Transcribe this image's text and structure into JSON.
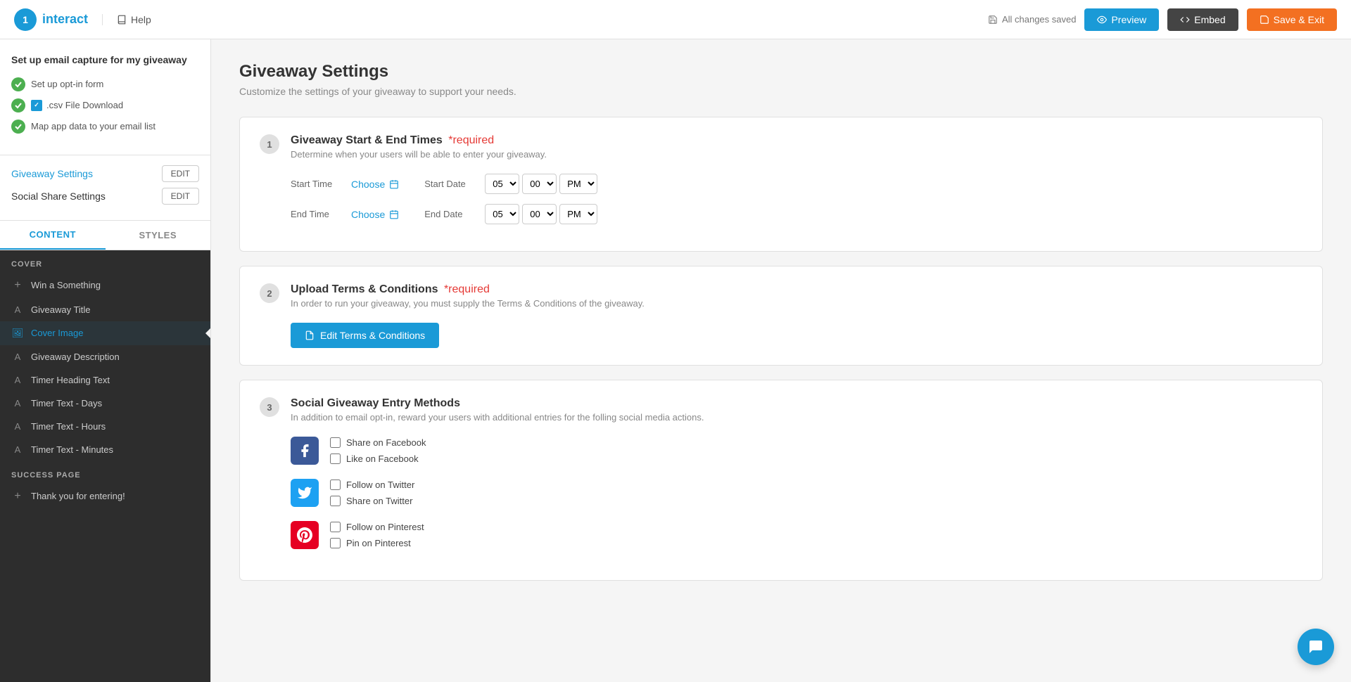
{
  "topbar": {
    "logo_text": "interact",
    "help_label": "Help",
    "saved_status": "All changes saved",
    "preview_label": "Preview",
    "embed_label": "Embed",
    "save_exit_label": "Save & Exit"
  },
  "sidebar": {
    "heading": "Set up email capture for my giveaway",
    "checklist": [
      {
        "label": "Set up opt-in form"
      },
      {
        "label": ".csv File Download",
        "has_icon": true
      },
      {
        "label": "Map app data to your email list"
      }
    ],
    "settings": [
      {
        "label": "Giveaway Settings",
        "active": true,
        "edit_label": "EDIT"
      },
      {
        "label": "Social Share Settings",
        "active": false,
        "edit_label": "EDIT"
      }
    ],
    "tabs": [
      {
        "label": "CONTENT",
        "active": true
      },
      {
        "label": "STYLES",
        "active": false
      }
    ],
    "cover_label": "COVER",
    "cover_items": [
      {
        "label": "Win a Something",
        "icon_type": "add"
      },
      {
        "label": "Giveaway Title",
        "icon_type": "text"
      },
      {
        "label": "Cover Image",
        "icon_type": "image",
        "active": true
      }
    ],
    "content_items": [
      {
        "label": "Giveaway Description",
        "icon_type": "text"
      },
      {
        "label": "Timer Heading Text",
        "icon_type": "text"
      },
      {
        "label": "Timer Text - Days",
        "icon_type": "text"
      },
      {
        "label": "Timer Text - Hours",
        "icon_type": "text"
      },
      {
        "label": "Timer Text - Minutes",
        "icon_type": "text"
      }
    ],
    "success_label": "SUCCESS PAGE",
    "success_items": [
      {
        "label": "Thank you for entering!",
        "icon_type": "add"
      }
    ]
  },
  "main": {
    "title": "Giveaway Settings",
    "subtitle": "Customize the settings of your giveaway to support your needs.",
    "sections": [
      {
        "number": "1",
        "title": "Giveaway Start & End Times",
        "required": "*required",
        "desc": "Determine when your users will be able to enter your giveaway.",
        "type": "time_picker",
        "start_time_label": "Start Time",
        "start_choose_label": "Choose",
        "start_date_label": "Start Date",
        "start_hour": "05",
        "start_min": "00",
        "start_ampm": "PM",
        "end_time_label": "End Time",
        "end_choose_label": "Choose",
        "end_date_label": "End Date",
        "end_hour": "05",
        "end_min": "00",
        "end_ampm": "PM"
      },
      {
        "number": "2",
        "title": "Upload Terms & Conditions",
        "required": "*required",
        "desc": "In order to run your giveaway, you must supply the Terms & Conditions of the giveaway.",
        "type": "terms",
        "btn_label": "Edit Terms & Conditions"
      },
      {
        "number": "3",
        "title": "Social Giveaway Entry Methods",
        "required": null,
        "desc": "In addition to email opt-in, reward your users with additional entries for the folling social media actions.",
        "type": "social",
        "social_options": [
          {
            "platform": "facebook",
            "options": [
              "Share on Facebook",
              "Like on Facebook"
            ]
          },
          {
            "platform": "twitter",
            "options": [
              "Follow on Twitter",
              "Share on Twitter"
            ]
          },
          {
            "platform": "pinterest",
            "options": [
              "Follow on Pinterest",
              "Pin on Pinterest"
            ]
          }
        ]
      }
    ]
  }
}
